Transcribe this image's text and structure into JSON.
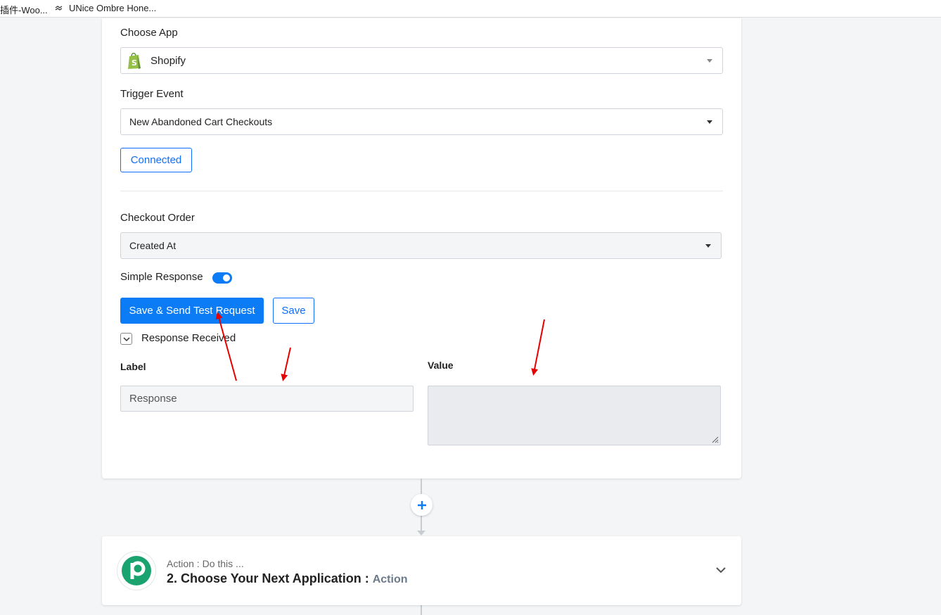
{
  "bookmarks": [
    {
      "label": "插件-Woo..."
    },
    {
      "label": "UNice Ombre Hone..."
    }
  ],
  "trigger": {
    "choose_app_label": "Choose App",
    "app_value": "Shopify",
    "trigger_event_label": "Trigger Event",
    "trigger_event_value": "New Abandoned Cart Checkouts",
    "connected_label": "Connected",
    "checkout_order_label": "Checkout Order",
    "checkout_order_value": "Created At",
    "simple_response_label": "Simple Response",
    "simple_response_on": true,
    "save_send_label": "Save & Send Test Request",
    "save_label": "Save",
    "response_received_label": "Response Received",
    "label_header": "Label",
    "value_header": "Value",
    "response_field_value": "Response",
    "value_field_value": ""
  },
  "action": {
    "subtitle": "Action : Do this ...",
    "title": "2. Choose Your Next Application :",
    "title_tag": "Action"
  },
  "colors": {
    "primary": "#0b7cf6",
    "shopify_green": "#95bf47",
    "pabbly_green": "#1aa36f",
    "annotation_red": "#e60000"
  }
}
